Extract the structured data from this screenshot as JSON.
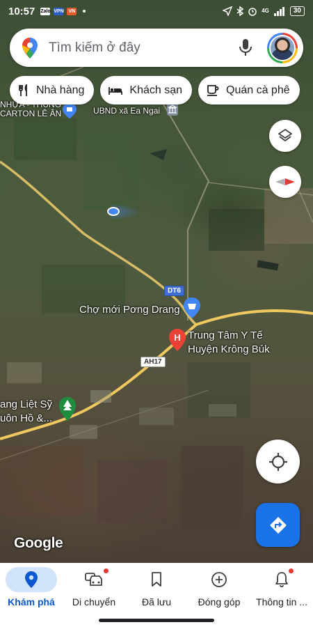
{
  "status_bar": {
    "time": "10:57",
    "app_icons": [
      "Zalo",
      "VPN",
      "VN"
    ],
    "battery": "30",
    "network": "4G"
  },
  "search": {
    "placeholder": "Tìm kiếm ở đây"
  },
  "chips": [
    {
      "label": "Nhà hàng",
      "icon": "fork-knife-icon"
    },
    {
      "label": "Khách sạn",
      "icon": "bed-icon"
    },
    {
      "label": "Quán cà phê",
      "icon": "coffee-cup-icon"
    }
  ],
  "map": {
    "labels": {
      "nhua_thung_line1": "NHỰA - THÙNG",
      "nhua_thung_line2": "CARTON LÊ ÂN",
      "ubnd": "UBND xã Ea Ngai",
      "cho_moi": "Chợ mới Pơng Drang",
      "trung_tam_line1": "Trung Tâm Y Tế",
      "trung_tam_line2": "Huyện Krông Búk",
      "liet_sy_line1": "ang Liệt Sỹ",
      "liet_sy_line2": "uôn Hồ &..."
    },
    "road_shields": {
      "dt6": "DT6",
      "ah17": "AH17"
    },
    "attribution": "Google"
  },
  "bottom_nav": [
    {
      "label": "Khám phá",
      "icon": "explore-pin-icon",
      "active": true,
      "badge": false
    },
    {
      "label": "Di chuyển",
      "icon": "car-icon",
      "active": false,
      "badge": true
    },
    {
      "label": "Đã lưu",
      "icon": "bookmark-icon",
      "active": false,
      "badge": false
    },
    {
      "label": "Đóng góp",
      "icon": "add-circle-icon",
      "active": false,
      "badge": false
    },
    {
      "label": "Thông tin ...",
      "icon": "bell-icon",
      "active": false,
      "badge": true
    }
  ],
  "colors": {
    "accent": "#1a73e8",
    "active_tab": "#0b57d0",
    "active_pill": "#d2e3fc",
    "badge": "#e53935",
    "marker_red": "#ea4335",
    "marker_blue": "#4285f4",
    "marker_green": "#1e8e3e"
  }
}
